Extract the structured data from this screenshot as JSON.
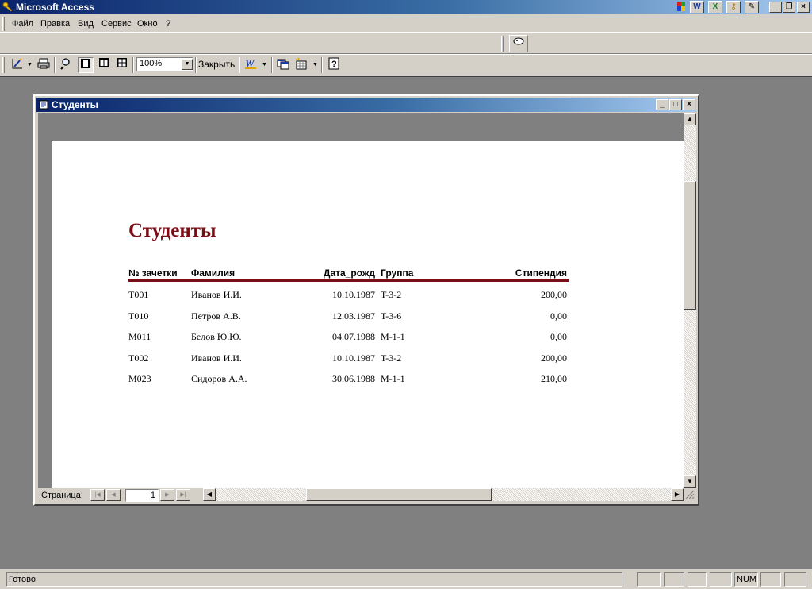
{
  "app": {
    "title": "Microsoft Access"
  },
  "menu": [
    "Файл",
    "Правка",
    "Вид",
    "Сервис",
    "Окно",
    "?"
  ],
  "toolbar": {
    "zoom": "100%",
    "close_label": "Закрыть"
  },
  "child_window": {
    "title": "Студенты"
  },
  "report": {
    "title": "Студенты",
    "headers": [
      "№ зачетки",
      "Фамилия",
      "Дата_рожд",
      "Группа",
      "Стипендия"
    ],
    "rows": [
      [
        "T001",
        "Иванов И.И.",
        "10.10.1987",
        "T-3-2",
        "200,00"
      ],
      [
        "T010",
        "Петров А.В.",
        "12.03.1987",
        "T-3-6",
        "0,00"
      ],
      [
        "M011",
        "Белов Ю.Ю.",
        "04.07.1988",
        "M-1-1",
        "0,00"
      ],
      [
        "T002",
        "Иванов И.И.",
        "10.10.1987",
        "T-3-2",
        "200,00"
      ],
      [
        "M023",
        "Сидоров А.А.",
        "30.06.1988",
        "M-1-1",
        "210,00"
      ]
    ]
  },
  "navigation": {
    "page_label": "Страница:",
    "page_number": "1"
  },
  "status": {
    "text": "Готово",
    "num": "NUM"
  },
  "colors": {
    "title_gradient_start": "#0a246a",
    "report_accent": "#7a0d16",
    "mdi_background": "#808080"
  }
}
